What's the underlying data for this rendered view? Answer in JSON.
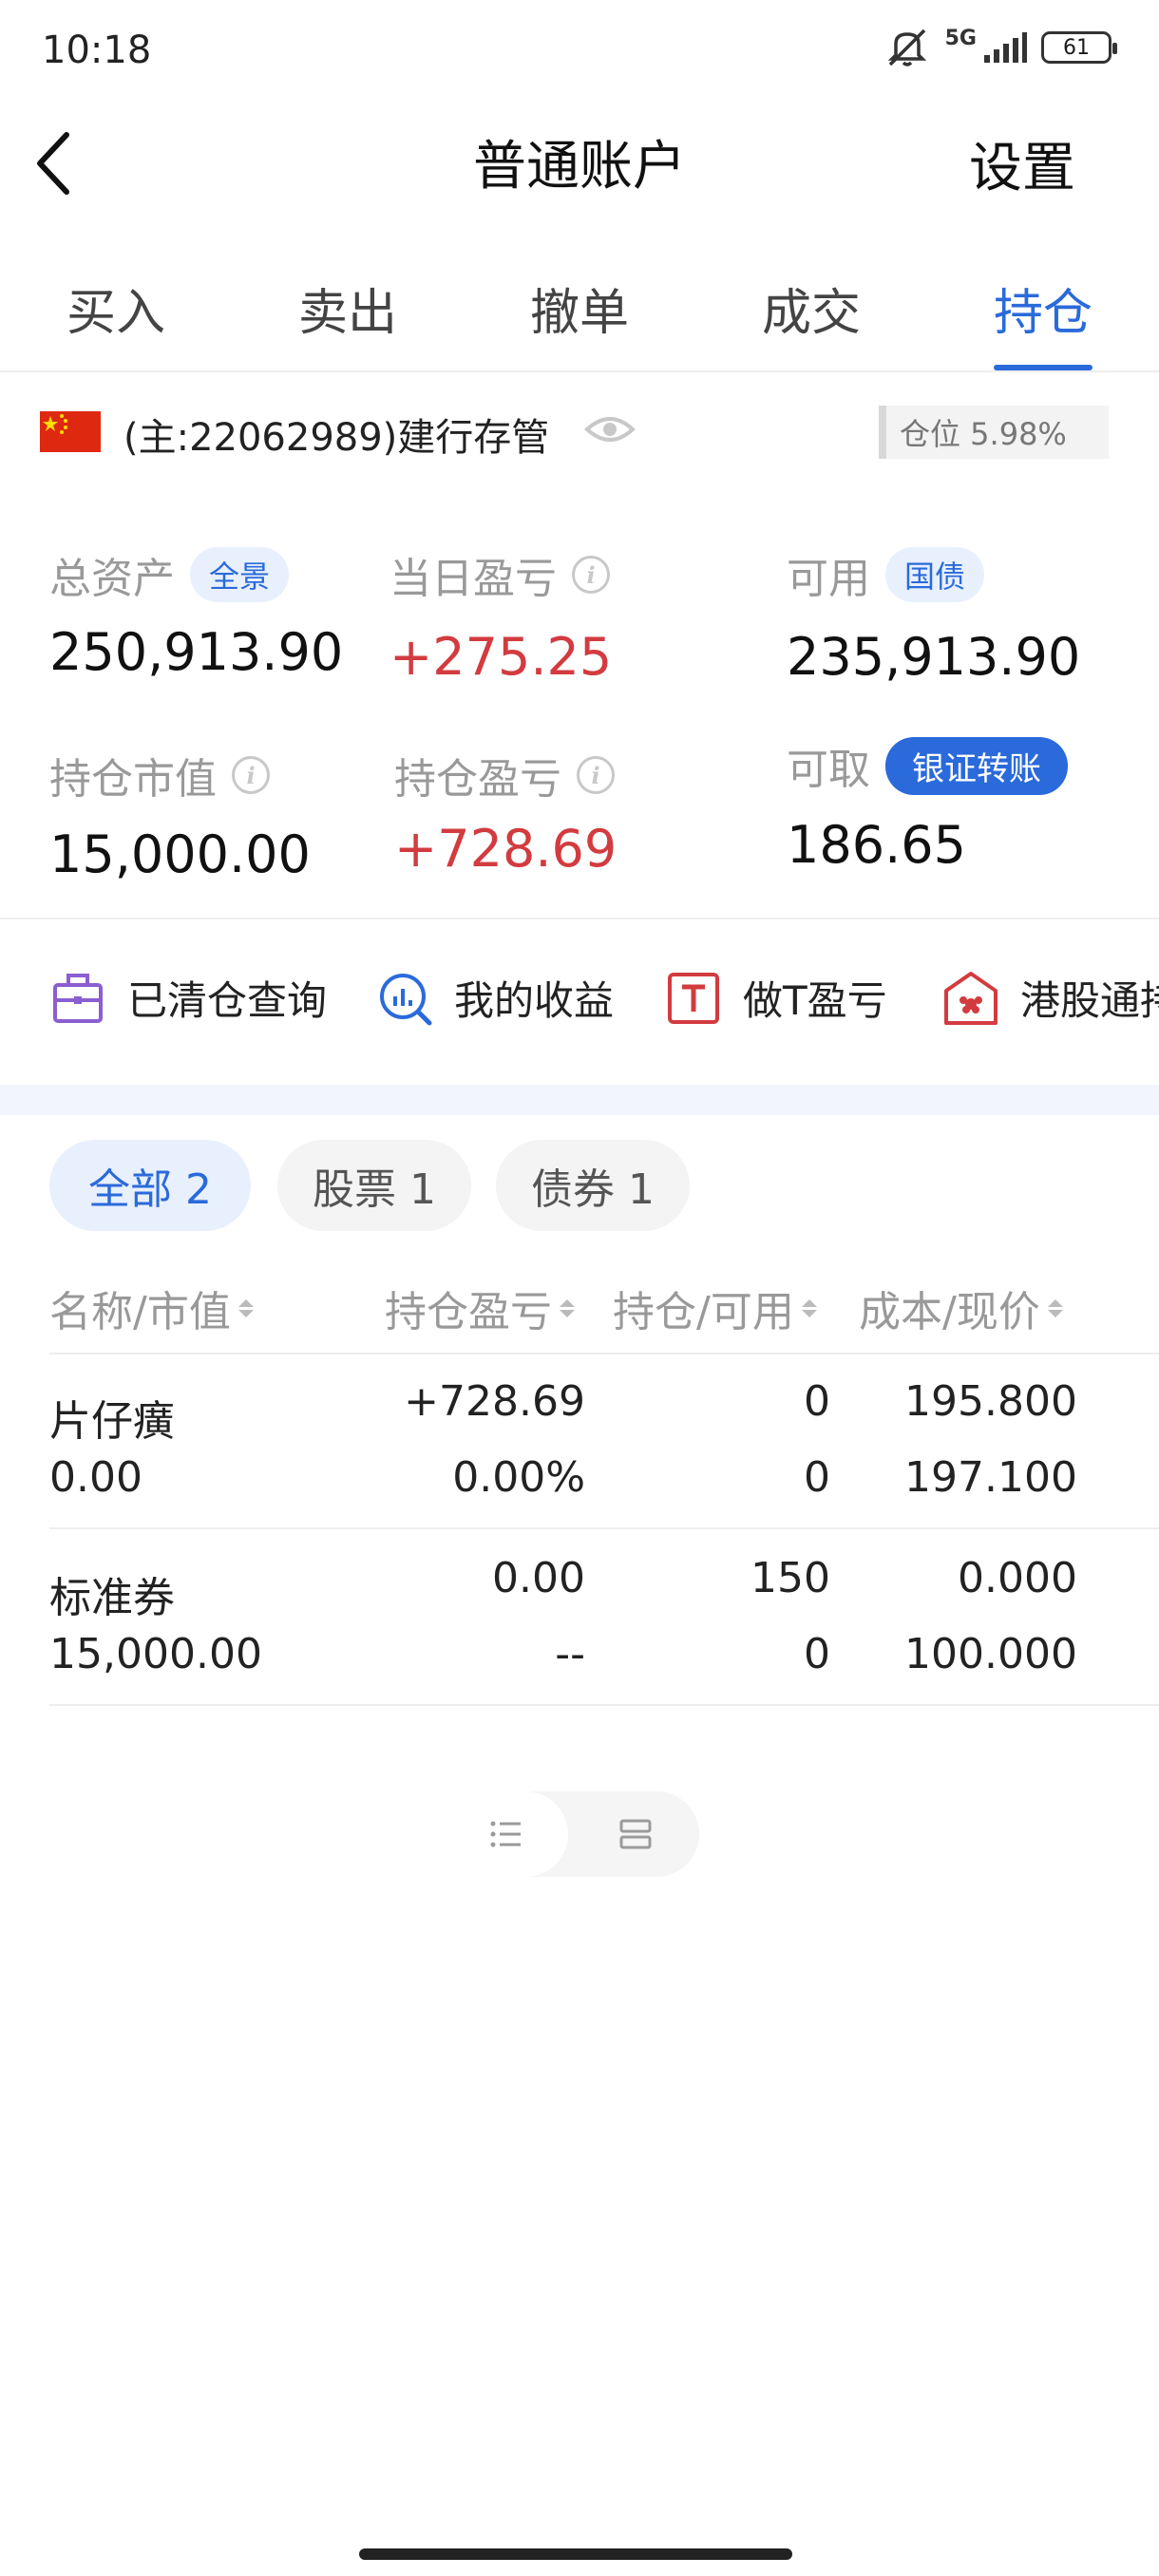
{
  "status_bar": {
    "time": "10:18",
    "network": "5G",
    "battery": "61"
  },
  "header": {
    "title": "普通账户",
    "settings_label": "设置"
  },
  "tabs": [
    {
      "label": "买入",
      "active": false
    },
    {
      "label": "卖出",
      "active": false
    },
    {
      "label": "撤单",
      "active": false
    },
    {
      "label": "成交",
      "active": false
    },
    {
      "label": "持仓",
      "active": true
    }
  ],
  "account": {
    "label": "(主:22062989)建行存管",
    "position_ratio": "仓位 5.98%"
  },
  "stats": {
    "total_assets": {
      "label": "总资产",
      "chip": "全景",
      "value": "250,913.90"
    },
    "daily_pnl": {
      "label": "当日盈亏",
      "value": "+275.25"
    },
    "available": {
      "label": "可用",
      "chip": "国债",
      "value": "235,913.90"
    },
    "market_value": {
      "label": "持仓市值",
      "value": "15,000.00"
    },
    "position_pnl": {
      "label": "持仓盈亏",
      "value": "+728.69"
    },
    "withdrawable": {
      "label": "可取",
      "chip": "银证转账",
      "value": "186.65"
    }
  },
  "quick_links": [
    {
      "label": "已清仓查询",
      "icon": "briefcase-icon"
    },
    {
      "label": "我的收益",
      "icon": "chart-search-icon"
    },
    {
      "label": "做T盈亏",
      "icon": "t-box-icon"
    },
    {
      "label": "港股通持",
      "icon": "hk-icon"
    }
  ],
  "filters": [
    {
      "label": "全部 2",
      "active": true
    },
    {
      "label": "股票 1",
      "active": false
    },
    {
      "label": "债券 1",
      "active": false
    }
  ],
  "table": {
    "columns": [
      "名称/市值",
      "持仓盈亏",
      "持仓/可用",
      "成本/现价"
    ],
    "rows": [
      {
        "name": "片仔癀",
        "market_value": "0.00",
        "pnl": "+728.69",
        "pnl_pct": "0.00%",
        "position": "0",
        "available": "0",
        "cost": "195.800",
        "price": "197.100"
      },
      {
        "name": "标准券",
        "market_value": "15,000.00",
        "pnl": "0.00",
        "pnl_pct": "--",
        "position": "150",
        "available": "0",
        "cost": "0.000",
        "price": "100.000"
      }
    ]
  },
  "colors": {
    "accent": "#2a6adb",
    "profit": "#d23b3f",
    "flag": "#de2910"
  }
}
